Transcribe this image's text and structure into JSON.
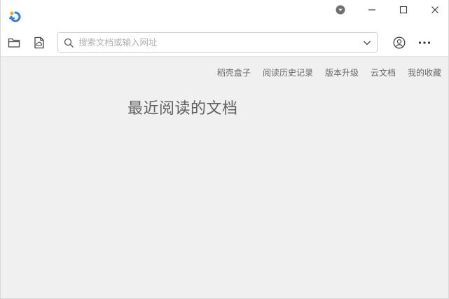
{
  "app": {
    "logo_icon": "wps-reader-logo",
    "accent": "#2b7de9"
  },
  "window_controls": {
    "menu_dropdown_icon": "dropdown-circle-icon",
    "minimize_icon": "minimize-icon",
    "maximize_icon": "maximize-icon",
    "close_icon": "close-icon"
  },
  "toolbar": {
    "open_folder_icon": "folder-icon",
    "cloud_doc_icon": "cloud-document-icon",
    "search": {
      "placeholder": "搜索文档或输入网址",
      "value": ""
    },
    "account_icon": "user-circle-icon",
    "more_icon": "more-horizontal-icon"
  },
  "nav_links": [
    {
      "label": "稻壳盒子"
    },
    {
      "label": "阅读历史记录"
    },
    {
      "label": "版本升级"
    },
    {
      "label": "云文档"
    },
    {
      "label": "我的收藏"
    }
  ],
  "recent": {
    "title": "最近阅读的文档"
  }
}
